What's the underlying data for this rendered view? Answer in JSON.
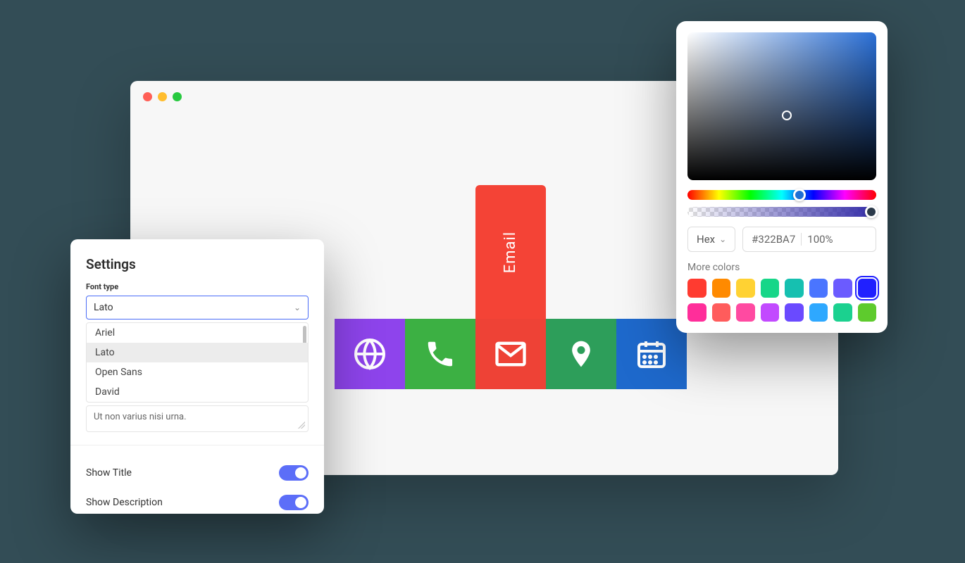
{
  "browser": {
    "email_popup_label": "Email"
  },
  "tiles": [
    {
      "name": "globe",
      "color": "#8e44ec"
    },
    {
      "name": "phone",
      "color": "#3cb043"
    },
    {
      "name": "email",
      "color": "#ee4236"
    },
    {
      "name": "location",
      "color": "#2d9e5a"
    },
    {
      "name": "calendar",
      "color": "#1e69cc"
    }
  ],
  "settings": {
    "title": "Settings",
    "font_type_label": "Font type",
    "font_selected": "Lato",
    "font_options": [
      "Ariel",
      "Lato",
      "Open Sans",
      "David"
    ],
    "textarea_value": "Ut non varius nisi urna.",
    "toggles": [
      {
        "label": "Show Title",
        "value": true
      },
      {
        "label": "Show Description",
        "value": true
      }
    ]
  },
  "picker": {
    "format_label": "Hex",
    "hex_value": "#322BA7",
    "alpha_value": "100%",
    "more_colors_label": "More colors",
    "swatches": [
      "#ff3b30",
      "#ff8a00",
      "#ffd233",
      "#17d688",
      "#16c0b0",
      "#4a75ff",
      "#6b5bff",
      "#2020ff",
      "#ff2e9a",
      "#ff5c5c",
      "#ff4aa1",
      "#c24aff",
      "#6a4aff",
      "#2ea8ff",
      "#1bd18f",
      "#5ecb2d"
    ],
    "selected_swatch_index": 7
  }
}
